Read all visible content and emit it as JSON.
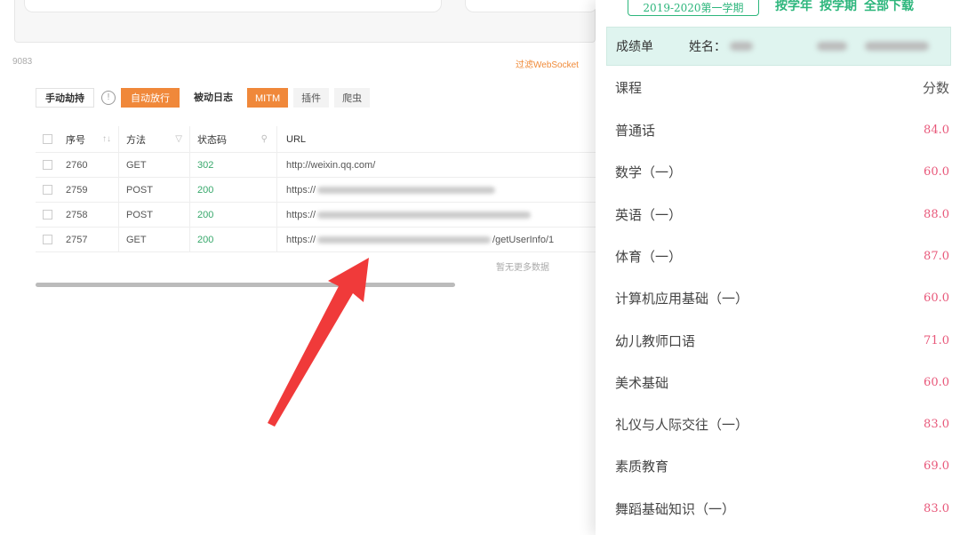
{
  "left": {
    "port": "9083",
    "ws_filter": "过滤WebSocket",
    "toolbar": {
      "manual": "手动劫持",
      "auto": "自动放行",
      "passive": "被动日志",
      "mitm": "MITM",
      "plugin": "插件",
      "crawler": "爬虫"
    },
    "table": {
      "headers": {
        "idx": "序号",
        "method": "方法",
        "status": "状态码",
        "url": "URL"
      },
      "rows": [
        {
          "idx": "2760",
          "method": "GET",
          "status": "302",
          "url": "http://weixin.qq.com/"
        },
        {
          "idx": "2759",
          "method": "POST",
          "status": "200",
          "url": "https://"
        },
        {
          "idx": "2758",
          "method": "POST",
          "status": "200",
          "url": "https://"
        },
        {
          "idx": "2757",
          "method": "GET",
          "status": "200",
          "url": "https://",
          "url_tail": "/getUserInfo/1"
        }
      ],
      "empty_text": "暂无更多数据"
    }
  },
  "panel": {
    "semester": "2019-2020第一学期",
    "links": [
      "按学年",
      "按学期",
      "全部下载"
    ],
    "sheet_title": "成绩单",
    "name_label": "姓名：",
    "col_course": "课程",
    "col_score": "分数",
    "grades": [
      {
        "course": "普通话",
        "score": "84.0"
      },
      {
        "course": "数学（一）",
        "score": "60.0"
      },
      {
        "course": "英语（一）",
        "score": "88.0"
      },
      {
        "course": "体育（一）",
        "score": "87.0"
      },
      {
        "course": "计算机应用基础（一）",
        "score": "60.0"
      },
      {
        "course": "幼儿教师口语",
        "score": "71.0"
      },
      {
        "course": "美术基础",
        "score": "60.0"
      },
      {
        "course": "礼仪与人际交往（一）",
        "score": "83.0"
      },
      {
        "course": "素质教育",
        "score": "69.0"
      },
      {
        "course": "舞蹈基础知识（一）",
        "score": "83.0"
      }
    ]
  },
  "colors": {
    "accent_orange": "#f0883a",
    "accent_green": "#2db67c",
    "score_pink": "#e8587a",
    "arrow_red": "#f03a3a"
  }
}
